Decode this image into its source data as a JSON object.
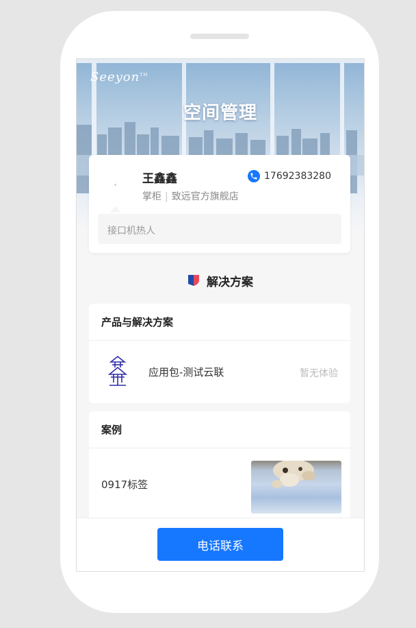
{
  "hero": {
    "logo_text": "Seeyon",
    "logo_mark": "TM",
    "title": "空间管理"
  },
  "profile": {
    "name": "王鑫鑫",
    "phone": "17692383280",
    "role": "掌柜",
    "separator": "|",
    "store": "致远官方旗舰店",
    "robot_label": "接口机热人"
  },
  "solutions": {
    "section_title": "解决方案",
    "products_card_title": "产品与解决方案",
    "app_name": "应用包-测试云联",
    "app_status": "暂无体验",
    "case_card_title": "案例",
    "case_label": "0917标签"
  },
  "footer": {
    "call_button_label": "电话联系"
  },
  "colors": {
    "accent": "#1677ff",
    "background": "#f6f6f7",
    "card": "#ffffff"
  },
  "icons": {
    "phone": "phone-icon",
    "solution": "shield-flag-icon",
    "app": "pagoda-app-icon"
  }
}
